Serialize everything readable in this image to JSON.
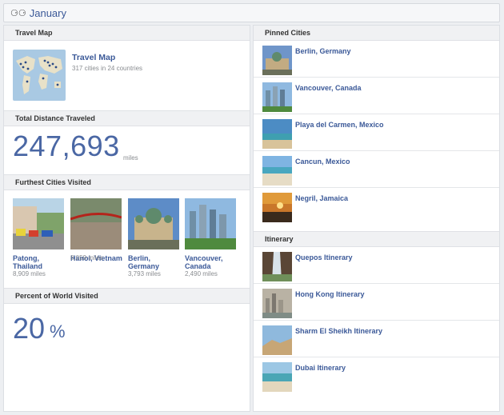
{
  "header": {
    "logo_glyph": "⚆⚆",
    "title": "January"
  },
  "travel_map": {
    "heading": "Travel Map",
    "title": "Travel Map",
    "subtitle": "317 cities in 24 countries"
  },
  "distance": {
    "heading": "Total Distance Traveled",
    "value": "247,693",
    "unit": "miles"
  },
  "furthest": {
    "heading": "Furthest Cities Visited",
    "items": [
      {
        "name1": "Patong,",
        "name2": "Thailand",
        "miles": "8,909 miles"
      },
      {
        "name1": "Hanoi, Vietnam",
        "name2": "",
        "miles": "8,059 miles"
      },
      {
        "name1": "Berlin,",
        "name2": "Germany",
        "miles": "3,793 miles"
      },
      {
        "name1": "Vancouver,",
        "name2": "Canada",
        "miles": "2,490 miles"
      }
    ]
  },
  "percent": {
    "heading": "Percent of World Visited",
    "value": "20",
    "symbol": "%"
  },
  "pinned": {
    "heading": "Pinned Cities",
    "items": [
      {
        "label": "Berlin, Germany"
      },
      {
        "label": "Vancouver, Canada"
      },
      {
        "label": "Playa del Carmen, Mexico"
      },
      {
        "label": "Cancun, Mexico"
      },
      {
        "label": "Negril, Jamaica"
      }
    ]
  },
  "itinerary": {
    "heading": "Itinerary",
    "items": [
      {
        "label": "Quepos Itinerary"
      },
      {
        "label": "Hong Kong Itinerary"
      },
      {
        "label": "Sharm El Sheikh Itinerary"
      },
      {
        "label": "Dubai Itinerary"
      }
    ]
  }
}
